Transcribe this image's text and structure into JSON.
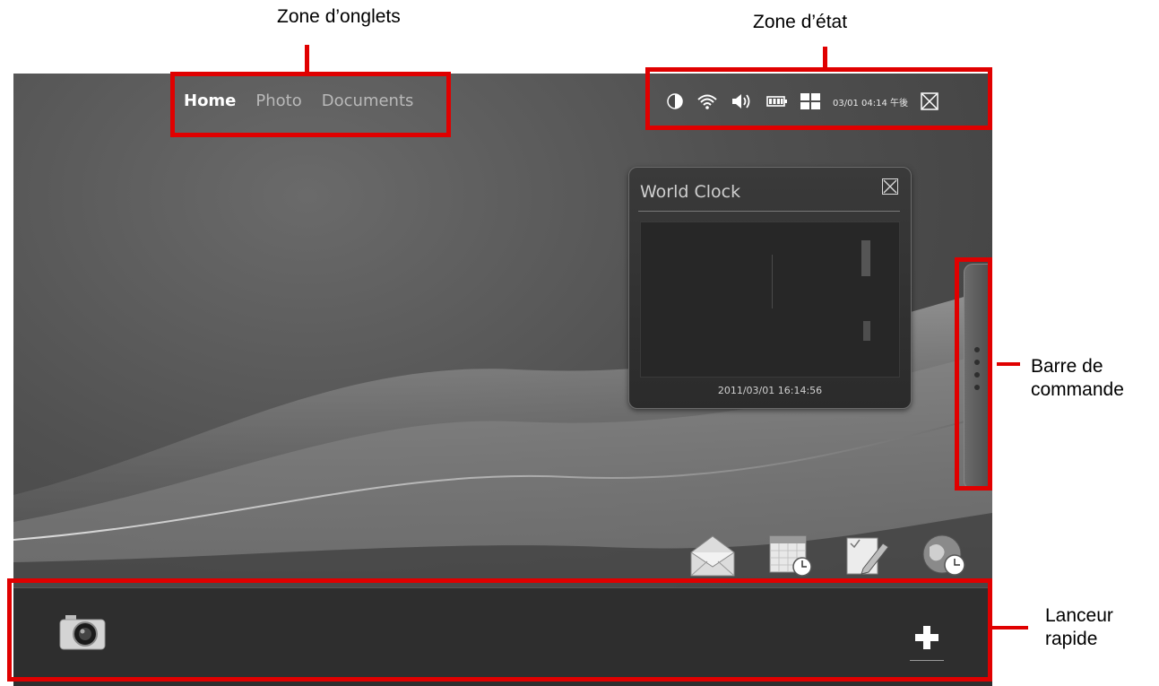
{
  "callouts": {
    "tabs_zone": "Zone d’onglets",
    "status_zone": "Zone d’état",
    "command_bar": [
      "Barre de",
      "commande"
    ],
    "quick_launcher": [
      "Lanceur",
      "rapide"
    ]
  },
  "tabs": [
    {
      "label": "Home",
      "active": true
    },
    {
      "label": "Photo",
      "active": false
    },
    {
      "label": "Documents",
      "active": false
    }
  ],
  "status": {
    "icons": [
      "brightness-icon",
      "wifi-icon",
      "volume-icon",
      "battery-icon",
      "layout-icon"
    ],
    "time": "03/01 04:14 午後"
  },
  "widget": {
    "title": "World Clock",
    "datetime": "2011/03/01 16:14:56"
  },
  "dock_icons": [
    "mail-icon",
    "calendar-icon",
    "notes-icon",
    "world-clock-icon"
  ],
  "launcher": {
    "icons": [
      "camera-icon",
      "add-icon"
    ]
  },
  "colors": {
    "annotation": "#e00000",
    "screen_bg": "#505050",
    "launcher_bg": "#2e2e2e"
  }
}
